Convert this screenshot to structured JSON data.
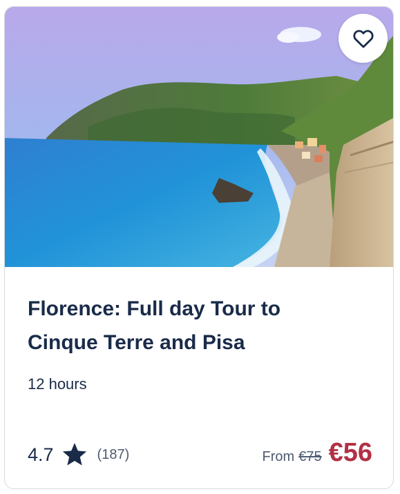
{
  "card": {
    "title": "Florence: Full day Tour to Cinque Terre and Pisa",
    "duration": "12 hours",
    "rating": "4.7",
    "reviews": "(187)",
    "price_prefix": "From",
    "original_price": "€75",
    "price": "€56",
    "wishlist_icon": "heart-icon",
    "star_icon": "star-icon",
    "image": "coastal-village-photo"
  },
  "colors": {
    "title": "#1a2b49",
    "price": "#b23044",
    "muted": "#4d5a70"
  }
}
